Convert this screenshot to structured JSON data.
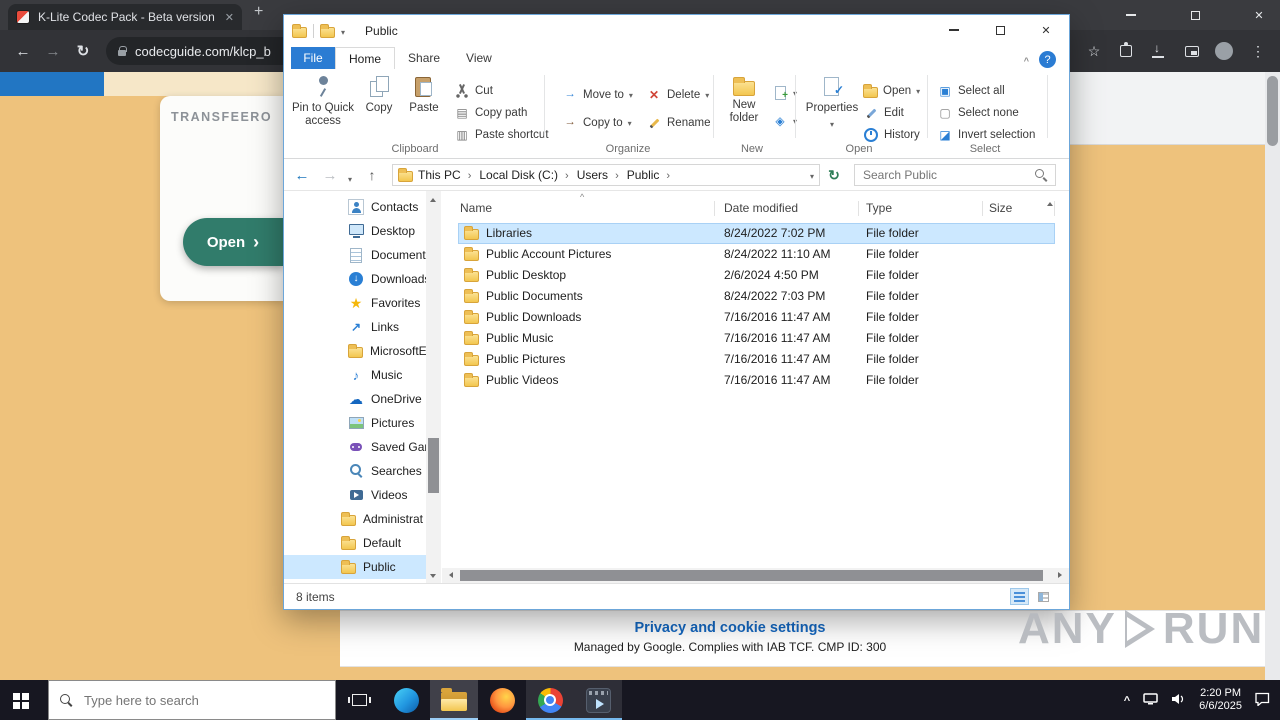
{
  "browser": {
    "tab_title": "K-Lite Codec Pack - Beta version",
    "url": "codecguide.com/klcp_b"
  },
  "page": {
    "brand": "TRANSFEERO",
    "open_button": "Open",
    "cookie_title": "Privacy and cookie settings",
    "cookie_subtitle": "Managed by Google. Complies with IAB TCF. CMP ID: 300"
  },
  "watermark": {
    "left": "ANY",
    "right": "RUN"
  },
  "explorer": {
    "title": "Public",
    "tabs": {
      "file": "File",
      "home": "Home",
      "share": "Share",
      "view": "View"
    },
    "ribbon": {
      "pin": "Pin to Quick access",
      "copy": "Copy",
      "paste": "Paste",
      "cut": "Cut",
      "copy_path": "Copy path",
      "paste_shortcut": "Paste shortcut",
      "clipboard_label": "Clipboard",
      "move_to": "Move to",
      "copy_to": "Copy to",
      "delete": "Delete",
      "rename": "Rename",
      "organize_label": "Organize",
      "new_folder": "New folder",
      "new_label": "New",
      "properties": "Properties",
      "open": "Open",
      "edit": "Edit",
      "history": "History",
      "open_label": "Open",
      "select_all": "Select all",
      "select_none": "Select none",
      "invert_selection": "Invert selection",
      "select_label": "Select"
    },
    "breadcrumb": {
      "items": [
        "This PC",
        "Local Disk (C:)",
        "Users",
        "Public"
      ]
    },
    "search_placeholder": "Search Public",
    "sidebar": [
      {
        "label": "Contacts",
        "icon": "contacts"
      },
      {
        "label": "Desktop",
        "icon": "monitor"
      },
      {
        "label": "Documents",
        "icon": "document"
      },
      {
        "label": "Downloads",
        "icon": "download"
      },
      {
        "label": "Favorites",
        "icon": "star"
      },
      {
        "label": "Links",
        "icon": "link"
      },
      {
        "label": "MicrosoftE",
        "icon": "folder"
      },
      {
        "label": "Music",
        "icon": "music"
      },
      {
        "label": "OneDrive",
        "icon": "cloud"
      },
      {
        "label": "Pictures",
        "icon": "picture"
      },
      {
        "label": "Saved Gam",
        "icon": "game"
      },
      {
        "label": "Searches",
        "icon": "search"
      },
      {
        "label": "Videos",
        "icon": "video"
      },
      {
        "label": "Administrat",
        "icon": "folder"
      },
      {
        "label": "Default",
        "icon": "folder"
      },
      {
        "label": "Public",
        "icon": "folder"
      }
    ],
    "columns": {
      "name": "Name",
      "date": "Date modified",
      "type": "Type",
      "size": "Size"
    },
    "files": [
      {
        "name": "Libraries",
        "date": "8/24/2022 7:02 PM",
        "type": "File folder"
      },
      {
        "name": "Public Account Pictures",
        "date": "8/24/2022 11:10 AM",
        "type": "File folder"
      },
      {
        "name": "Public Desktop",
        "date": "2/6/2024 4:50 PM",
        "type": "File folder"
      },
      {
        "name": "Public Documents",
        "date": "8/24/2022 7:03 PM",
        "type": "File folder"
      },
      {
        "name": "Public Downloads",
        "date": "7/16/2016 11:47 AM",
        "type": "File folder"
      },
      {
        "name": "Public Music",
        "date": "7/16/2016 11:47 AM",
        "type": "File folder"
      },
      {
        "name": "Public Pictures",
        "date": "7/16/2016 11:47 AM",
        "type": "File folder"
      },
      {
        "name": "Public Videos",
        "date": "7/16/2016 11:47 AM",
        "type": "File folder"
      }
    ],
    "status": "8 items"
  },
  "taskbar": {
    "search_placeholder": "Type here to search",
    "time": "2:20 PM",
    "date": "6/6/2025"
  }
}
